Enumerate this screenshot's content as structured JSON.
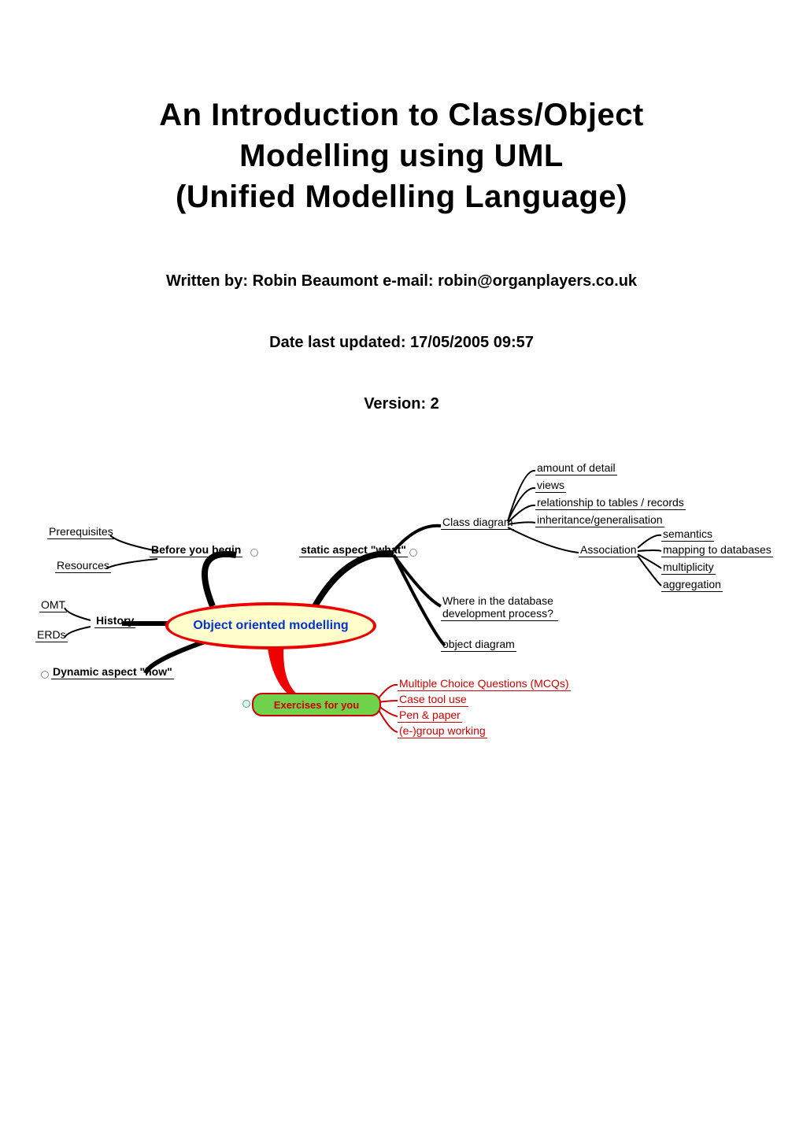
{
  "title_line1": "An Introduction to Class/Object",
  "title_line2": "Modelling using UML",
  "title_line3": "(Unified Modelling Language)",
  "byline": "Written by: Robin Beaumont e-mail: robin@organplayers.co.uk",
  "updated": "Date last updated: 17/05/2005 09:57",
  "version": "Version: 2",
  "mindmap": {
    "center": "Object oriented modelling",
    "before_you_begin": {
      "label": "Before you begin",
      "children": {
        "prerequisites": "Prerequisites",
        "resources": "Resources"
      }
    },
    "history": {
      "label": "History",
      "children": {
        "omt": "OMT",
        "erds": "ERDs"
      }
    },
    "dynamic_aspect": "Dynamic aspect \"how\"",
    "static_aspect": {
      "label": "static aspect \"what\"",
      "class_diagram": {
        "label": "Class diagram",
        "children": {
          "amount_of_detail": "amount of detail",
          "views": "views",
          "relationship": "relationship to tables / records",
          "inheritance": "inheritance/generalisation",
          "association": {
            "label": "Association",
            "children": {
              "semantics": "semantics",
              "mapping": "mapping to databases",
              "multiplicity": "multiplicity",
              "aggregation": "aggregation"
            }
          }
        }
      },
      "where_in_db": "Where in the database development process?",
      "object_diagram": "object diagram"
    },
    "exercises": {
      "label": "Exercises for you",
      "children": {
        "mcq": "Multiple Choice Questions (MCQs)",
        "case_tool": "Case tool use",
        "pen_paper": "Pen & paper",
        "group": "(e-)group working"
      }
    }
  }
}
